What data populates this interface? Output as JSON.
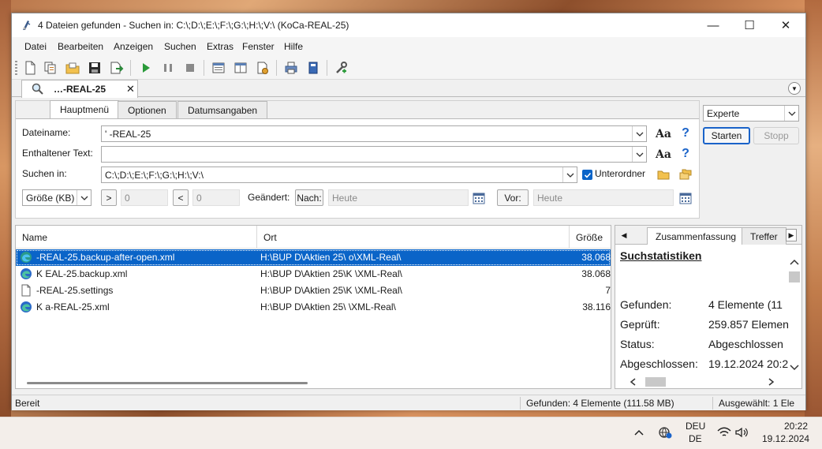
{
  "window": {
    "title": "4 Dateien gefunden - Suchen in: C:\\;D:\\;E:\\;F:\\;G:\\;H:\\;V:\\ (KoCa-REAL-25)",
    "controls": {
      "minimize": "—",
      "maximize": "☐",
      "close": "✕"
    }
  },
  "menu": [
    "Datei",
    "Bearbeiten",
    "Anzeigen",
    "Suchen",
    "Extras",
    "Fenster",
    "Hilfe"
  ],
  "toolbar": {
    "icons": [
      "new-search-icon",
      "copy-icon",
      "open-folder-icon",
      "save-icon",
      "export-icon",
      "play-icon",
      "pause-icon",
      "stop-icon",
      "layout-icon",
      "columns-icon",
      "settings-icon",
      "print-icon",
      "book-icon",
      "tools-icon"
    ]
  },
  "doc_tab": {
    "label": "…-REAL-25",
    "close": "✕"
  },
  "search_tabs": [
    "Hauptmenü",
    "Optionen",
    "Datumsangaben"
  ],
  "form": {
    "dateiname_label": "Dateiname:",
    "dateiname_value": "'      -REAL-25",
    "text_label": "Enthaltener Text:",
    "text_value": "",
    "suchen_label": "Suchen in:",
    "suchen_value": "C:\\;D:\\;E:\\;F:\\;G:\\;H:\\;V:\\",
    "unterordner_label": "Unterordner",
    "aa_label": "Aa",
    "help_label": "?",
    "size_unit": "Größe (KB)",
    "gt": ">",
    "gt_value": "0",
    "lt": "<",
    "lt_value": "0",
    "changed_label": "Geändert:",
    "nach_btn": "Nach:",
    "nach_value": "Heute",
    "vor_btn": "Vor:",
    "vor_value": "Heute"
  },
  "right": {
    "mode": "Experte",
    "start": "Starten",
    "stop": "Stopp"
  },
  "results": {
    "columns": [
      "Name",
      "Ort",
      "Größe"
    ],
    "rows": [
      {
        "name": "-REAL-25.backup-after-open.xml",
        "ort": "H:\\BUP D\\Aktien 25\\        o\\XML-Real\\",
        "size": "38.068",
        "icon": "edge-icon",
        "selected": true
      },
      {
        "name": "K       EAL-25.backup.xml",
        "ort": "H:\\BUP D\\Aktien 25\\K          \\XML-Real\\",
        "size": "38.068",
        "icon": "edge-icon",
        "selected": false
      },
      {
        "name": "-REAL-25.settings",
        "ort": "H:\\BUP D\\Aktien 25\\K          \\XML-Real\\",
        "size": "7",
        "icon": "file-icon",
        "selected": false
      },
      {
        "name": "K    a-REAL-25.xml",
        "ort": "H:\\BUP D\\Aktien 25\\        \\XML-Real\\",
        "size": "38.116",
        "icon": "edge-icon",
        "selected": false
      }
    ]
  },
  "stats": {
    "tabs": [
      "Zusammenfassung",
      "Treffer"
    ],
    "heading": "Suchstatistiken",
    "items": [
      {
        "label": "Gefunden:",
        "value": "4 Elemente (11"
      },
      {
        "label": "Geprüft:",
        "value": "259.857 Elemen"
      },
      {
        "label": "Status:",
        "value": "Abgeschlossen"
      },
      {
        "label": "Abgeschlossen:",
        "value": "19.12.2024 20:2"
      }
    ]
  },
  "statusbar": {
    "left": "Bereit",
    "found": "Gefunden: 4 Elemente (111.58 MB)",
    "selected": "Ausgewählt: 1 Ele"
  },
  "taskbar": {
    "lang1": "DEU",
    "lang2": "DE",
    "time": "20:22",
    "date": "19.12.2024"
  }
}
